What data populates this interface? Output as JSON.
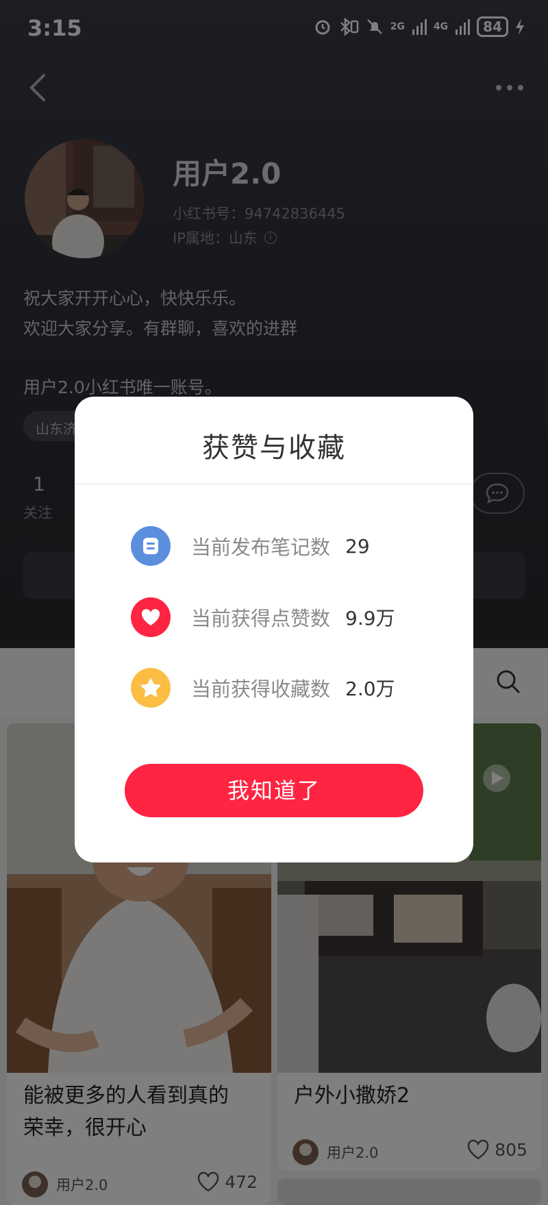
{
  "status_bar": {
    "time": "3:15",
    "net1": "2G",
    "net2": "4G",
    "battery": "84"
  },
  "profile": {
    "username": "用户2.0",
    "red_id": "小红书号：94742836445",
    "ip_location": "IP属地：山东",
    "bio_line1": "祝大家开开心心，快快乐乐。",
    "bio_line2": "欢迎大家分享。有群聊，喜欢的进群",
    "bio_line3": "用户2.0小红书唯一账号。",
    "tag": "山东济",
    "follow_count": "1",
    "follow_label": "关注"
  },
  "feed": {
    "cards": [
      {
        "title_line1": "能被更多的人看到真的",
        "title_line2": "荣幸，很开心",
        "author": "用户2.0",
        "likes": "472"
      },
      {
        "title_line1": "户外小撒娇2",
        "author": "用户2.0",
        "likes": "805"
      }
    ]
  },
  "dialog": {
    "title": "获赞与收藏",
    "stats": [
      {
        "label": "当前发布笔记数",
        "value": "29",
        "icon": "note-icon",
        "color": "#5b8fde"
      },
      {
        "label": "当前获得点赞数",
        "value": "9.9万",
        "icon": "heart-icon",
        "color": "#ff2442"
      },
      {
        "label": "当前获得收藏数",
        "value": "2.0万",
        "icon": "star-icon",
        "color": "#fcbd45"
      }
    ],
    "confirm_label": "我知道了"
  }
}
